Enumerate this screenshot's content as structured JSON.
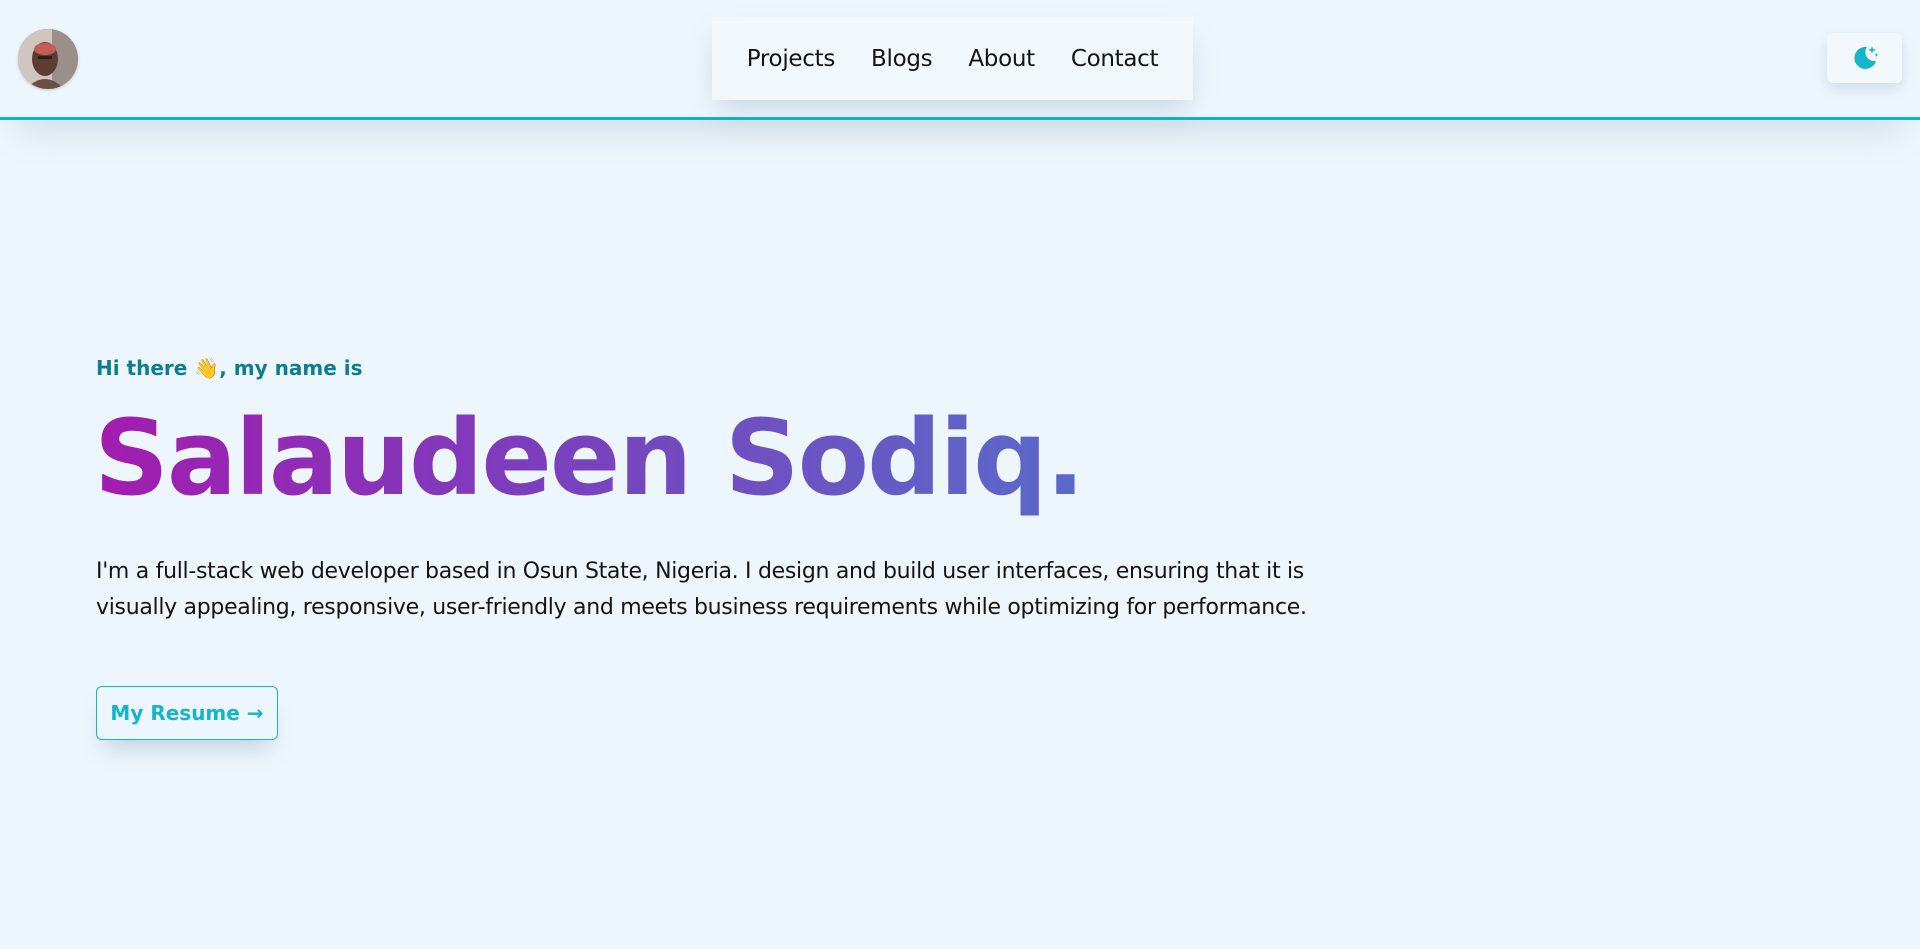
{
  "header": {
    "nav": {
      "items": [
        {
          "label": "Projects"
        },
        {
          "label": "Blogs"
        },
        {
          "label": "About"
        },
        {
          "label": "Contact"
        }
      ]
    },
    "theme_toggle": {
      "icon": "moon-stars-icon",
      "accent": "#14b5c9"
    },
    "avatar": {
      "icon": "profile-photo"
    }
  },
  "hero": {
    "greeting": "Hi there 👋, my name is",
    "name": "Salaudeen Sodiq.",
    "description": "I'm a full-stack web developer based in Osun State, Nigeria. I design and build user interfaces, ensuring that it is visually appealing, responsive, user-friendly and meets business requirements while optimizing for performance.",
    "resume_button": "My Resume →"
  },
  "colors": {
    "background": "#eef6fd",
    "accent": "#14b5c9",
    "greeting": "#0d7e8f",
    "name_gradient_start": "#a21caf",
    "name_gradient_end": "#5a6ac9"
  }
}
